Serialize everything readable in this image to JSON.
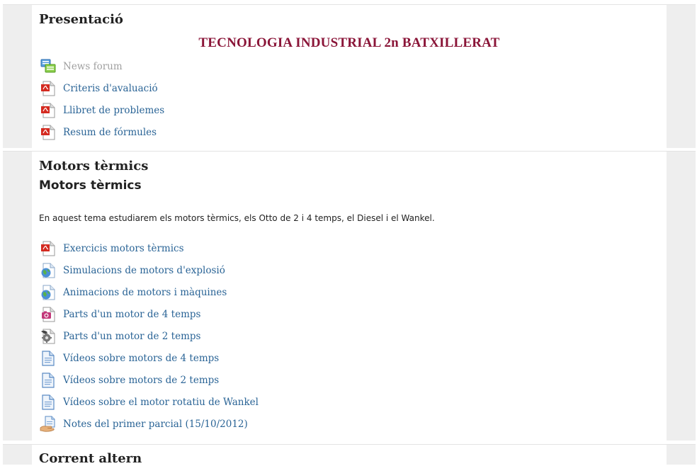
{
  "course": {
    "colors": {
      "side_bar": "#eeeeee",
      "link": "#2a6496",
      "dimmed_link": "#a0a0a0",
      "headline": "#8a1538"
    },
    "presentation": {
      "title": "Presentació",
      "headline": "TECNOLOGIA INDUSTRIAL 2n BATXILLERAT",
      "activities": [
        {
          "label": "News forum",
          "icon": "forum-icon",
          "dimmed": true
        },
        {
          "label": "Criteris d'avaluació",
          "icon": "pdf-icon"
        },
        {
          "label": "Llibret de problemes",
          "icon": "pdf-icon"
        },
        {
          "label": "Resum de fórmules",
          "icon": "pdf-icon"
        }
      ]
    },
    "motors": {
      "title": "Motors tèrmics",
      "subheading": "Motors tèrmics",
      "summary": "En aquest tema estudiarem els motors tèrmics, els Otto de 2 i 4 temps, el Diesel i el Wankel.",
      "activities": [
        {
          "label": "Exercicis motors tèrmics",
          "icon": "pdf-icon"
        },
        {
          "label": "Simulacions de motors d'explosió",
          "icon": "web-link-icon"
        },
        {
          "label": "Animacions de motors i màquines",
          "icon": "web-link-icon"
        },
        {
          "label": "Parts d'un motor de 4 temps",
          "icon": "image-file-icon"
        },
        {
          "label": "Parts d'un motor de 2 temps",
          "icon": "flash-file-icon"
        },
        {
          "label": "Vídeos sobre motors de 4 temps",
          "icon": "document-icon"
        },
        {
          "label": "Vídeos sobre motors de 2 temps",
          "icon": "document-icon"
        },
        {
          "label": "Vídeos sobre el motor rotatiu de Wankel",
          "icon": "document-icon"
        },
        {
          "label": "Notes del primer parcial (15/10/2012)",
          "icon": "assignment-hand-icon"
        }
      ]
    },
    "corrent": {
      "title": "Corrent altern"
    }
  }
}
